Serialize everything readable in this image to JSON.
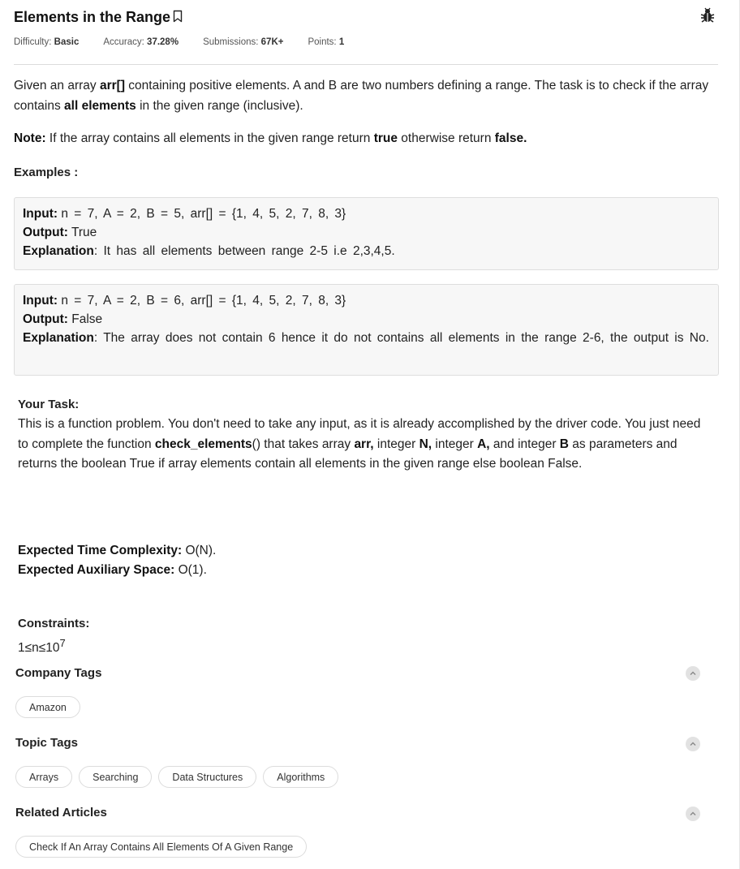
{
  "problem": {
    "title": "Elements in the Range",
    "meta": {
      "difficulty_label": "Difficulty:",
      "difficulty": "Basic",
      "accuracy_label": "Accuracy:",
      "accuracy": "37.28%",
      "submissions_label": "Submissions:",
      "submissions": "67K+",
      "points_label": "Points:",
      "points": "1"
    },
    "description": {
      "t1": "Given an array ",
      "b1": "arr[]",
      "t2": " containing positive elements. A and B are two numbers defining a range. The task is to check if the array contains ",
      "b2": "all elements",
      "t3": " in the given range (inclusive)."
    },
    "note": {
      "label": "Note:",
      "t1": " If the array contains all elements in the given range return ",
      "b1": "true",
      "t2": " otherwise return ",
      "b2": "false."
    },
    "examples_heading": "Examples :",
    "examples": [
      {
        "input_label": "Input:",
        "input": "n = 7, A = 2, B = 5, arr[] =  {1, 4, 5, 2, 7, 8, 3}",
        "output_label": "Output:",
        "output": "True",
        "explanation_label": "Explanation",
        "explanation": ": It has all elements between range 2-5 i.e 2,3,4,5."
      },
      {
        "input_label": "Input:",
        "input": "n = 7, A = 2, B = 6, arr[] = {1, 4, 5, 2, 7, 8, 3}",
        "output_label": "Output:",
        "output": "False",
        "explanation_label": "Explanation",
        "explanation": ": The array does not contain 6 hence it do not contains all elements in the range 2-6, the output is No."
      }
    ],
    "task": {
      "heading": "Your Task:",
      "t1": "This is a function problem. You don't need to take any input, as it is already accomplished by the driver code. You just need to complete the function ",
      "fn": "check_elements",
      "t2": "() that takes array ",
      "b1": "arr,",
      "t3": " integer ",
      "b2": "N,",
      "t4": " integer ",
      "b3": "A,",
      "t5": " and integer ",
      "b4": "B",
      "t6": "  as parameters and returns the boolean True if array elements contain all elements in the given range else boolean False."
    },
    "complexity": {
      "time_label": "Expected Time Complexity:",
      "time": " O(N).",
      "space_label": "Expected Auxiliary Space:",
      "space": " O(1)."
    },
    "constraints": {
      "heading": "Constraints:",
      "expr": "1≤n≤10",
      "exp": "7"
    }
  },
  "company_tags": {
    "heading": "Company Tags",
    "items": [
      "Amazon"
    ]
  },
  "topic_tags": {
    "heading": "Topic Tags",
    "items": [
      "Arrays",
      "Searching",
      "Data Structures",
      "Algorithms"
    ]
  },
  "related_articles": {
    "heading": "Related Articles",
    "items": [
      "Check If An Array Contains All Elements Of A Given Range"
    ]
  },
  "icons": {
    "bookmark": "bookmark-icon",
    "bug": "bug-report-icon",
    "collapse": "chevron-up-icon"
  }
}
